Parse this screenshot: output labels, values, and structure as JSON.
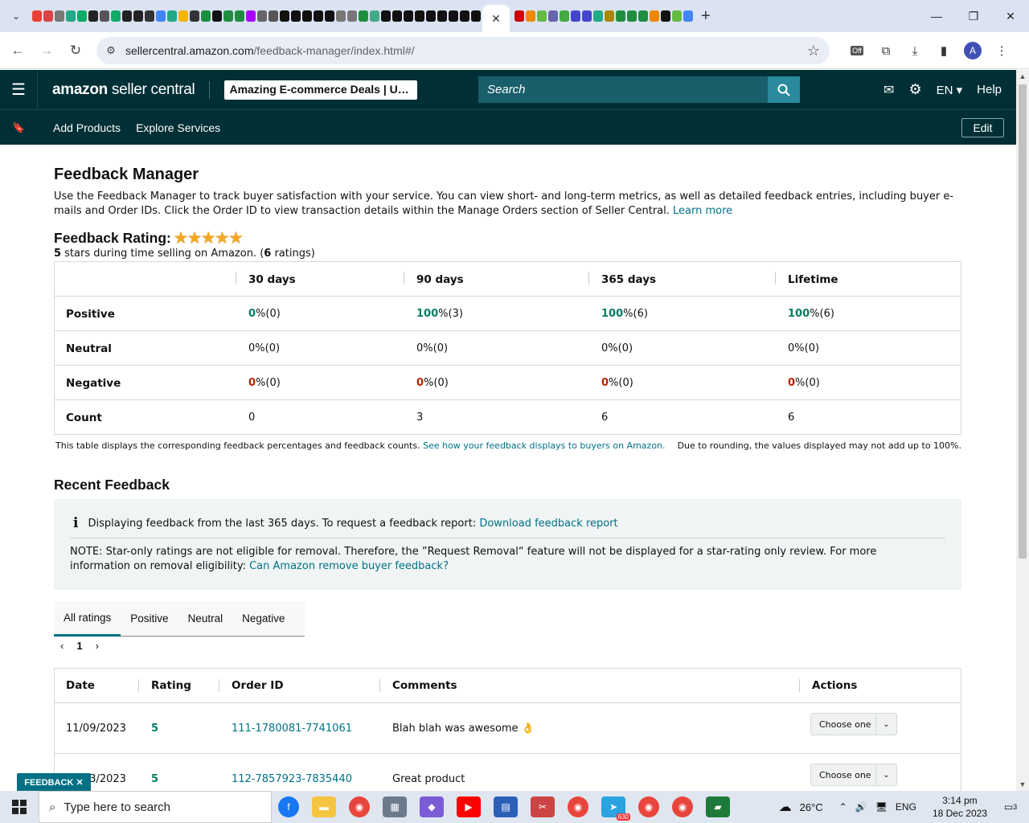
{
  "browser": {
    "url_host": "sellercentral.amazon.com",
    "url_path": "/feedback-manager/index.html#/",
    "active_tab_close": "✕",
    "newtab": "+",
    "profile_initial": "A",
    "extension_badge": "Off"
  },
  "header": {
    "logo_bold": "amazon",
    "logo_rest": " seller central",
    "store": "Amazing E-commerce Deals | Uni...",
    "search_placeholder": "Search",
    "lang": "EN",
    "help": "Help",
    "nav_links": [
      "Add Products",
      "Explore Services"
    ],
    "edit": "Edit"
  },
  "page": {
    "title": "Feedback Manager",
    "intro": "Use the Feedback Manager to track buyer satisfaction with your service. You can view short- and long-term metrics, as well as detailed feedback entries, including buyer e-mails and Order IDs. Click the Order ID to view transaction details within the Manage Orders section of Seller Central.",
    "learn_more": "Learn more",
    "rating_label": "Feedback Rating:",
    "stars": "★★★★★",
    "star_count": 5,
    "rating_sub_num": "5",
    "rating_sub_text": " stars during time selling on Amazon. (",
    "rating_sub_count": "6",
    "rating_sub_end": " ratings)"
  },
  "metrics": {
    "columns": [
      "30 days",
      "90 days",
      "365 days",
      "Lifetime"
    ],
    "rows": [
      {
        "label": "Positive",
        "cells": [
          [
            "0",
            " %(0)"
          ],
          [
            "100",
            " %(3)"
          ],
          [
            "100",
            " %(6)"
          ],
          [
            "100",
            " %(6)"
          ]
        ]
      },
      {
        "label": "Neutral",
        "cells": [
          [
            "0",
            " %(0)"
          ],
          [
            "0",
            " %(0)"
          ],
          [
            "0",
            " %(0)"
          ],
          [
            "0",
            " %(0)"
          ]
        ]
      },
      {
        "label": "Negative",
        "cells": [
          [
            "0",
            " %(0)"
          ],
          [
            "0",
            " %(0)"
          ],
          [
            "0",
            " %(0)"
          ],
          [
            "0",
            " %(0)"
          ]
        ]
      },
      {
        "label": "Count",
        "cells": [
          [
            "0",
            ""
          ],
          [
            "3",
            ""
          ],
          [
            "6",
            ""
          ],
          [
            "6",
            ""
          ]
        ]
      }
    ],
    "note": "This table displays the corresponding feedback percentages and feedback counts.",
    "note_link": "See how your feedback displays to buyers on Amazon.",
    "note_right": "Due to rounding, the values displayed may not add up to 100%."
  },
  "recent": {
    "title": "Recent Feedback",
    "info_text": "Displaying feedback from the last 365 days. To request a feedback report:",
    "info_link": "Download feedback report",
    "note_text": "NOTE: Star-only ratings are not eligible for removal. Therefore, the ”Request Removal“ feature will not be displayed for a star-rating only review. For more information on removal eligibility:",
    "note_link": "Can Amazon remove buyer feedback?",
    "tabs": [
      "All ratings",
      "Positive",
      "Neutral",
      "Negative"
    ],
    "page": "1",
    "columns": [
      "Date",
      "Rating",
      "Order ID",
      "Comments",
      "Actions"
    ],
    "rows": [
      {
        "date": "11/09/2023",
        "rating": "5",
        "order": "111-1780081-7741061",
        "comment": "Blah blah was awesome 👌",
        "action": "Choose one"
      },
      {
        "date": "10/13/2023",
        "rating": "5",
        "order": "112-7857923-7835440",
        "comment": "Great product",
        "action": "Choose one"
      }
    ],
    "feedback_tab": "FEEDBACK ✕"
  },
  "taskbar": {
    "search_placeholder": "Type here to search",
    "temperature": "26°C",
    "lang": "ENG",
    "time": "3:14 pm",
    "date": "18 Dec 2023",
    "notifications": "3",
    "telegram_badge": "630"
  }
}
